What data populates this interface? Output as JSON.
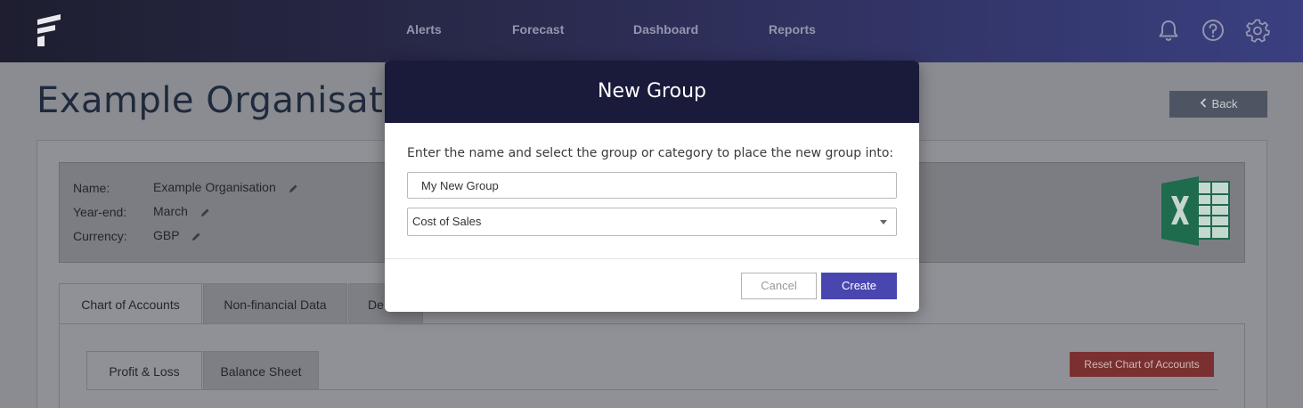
{
  "topbar": {
    "logo_icon": "app-logo-f",
    "nav": [
      {
        "label": "Alerts"
      },
      {
        "label": "Forecast"
      },
      {
        "label": "Dashboard"
      },
      {
        "label": "Reports"
      }
    ],
    "icons": [
      "bell-icon",
      "help-icon",
      "gear-icon"
    ]
  },
  "page": {
    "title": "Example Organisation",
    "back_label": "Back",
    "info": {
      "name_label": "Name:",
      "name_value": "Example Organisation",
      "yearend_label": "Year-end:",
      "yearend_value": "March",
      "currency_label": "Currency:",
      "currency_value": "GBP"
    },
    "export_icon": "excel-icon",
    "tabs": [
      {
        "label": "Chart of Accounts"
      },
      {
        "label": "Non-financial Data"
      },
      {
        "label": "De"
      }
    ],
    "subtabs": [
      {
        "label": "Profit & Loss"
      },
      {
        "label": "Balance Sheet"
      }
    ],
    "reset_label": "Reset Chart of Accounts"
  },
  "modal": {
    "title": "New Group",
    "prompt": "Enter the name and select the group or category to place the new group into:",
    "name_value": "My New Group",
    "category_value": "Cost of Sales",
    "cancel_label": "Cancel",
    "create_label": "Create"
  },
  "colors": {
    "header_bg": "#1a1a3b",
    "primary": "#4a46b0",
    "danger": "#7a3030"
  }
}
